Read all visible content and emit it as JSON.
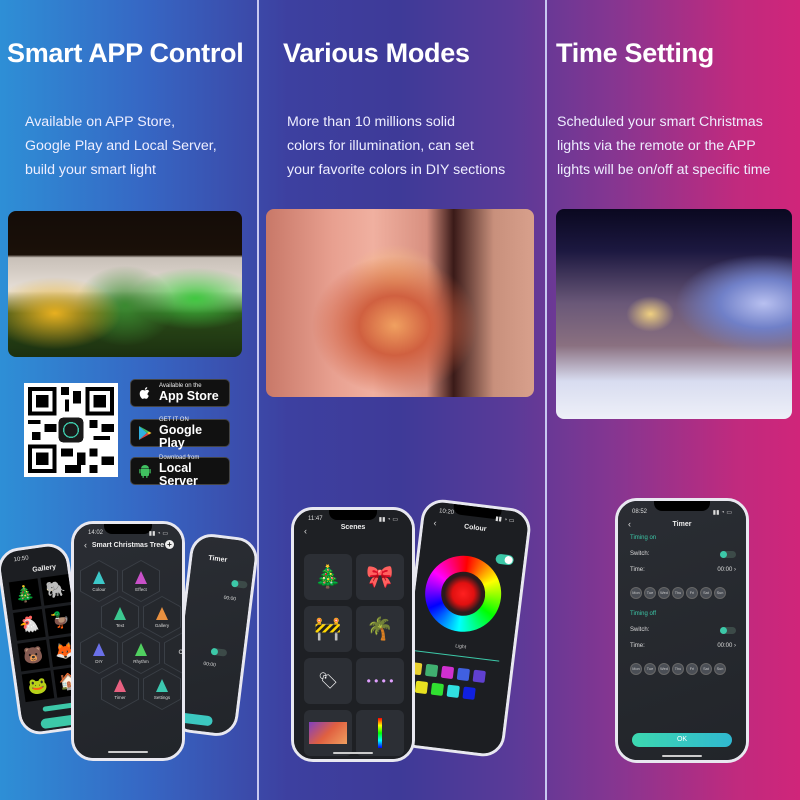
{
  "columns": [
    {
      "title": "Smart APP Control",
      "description": [
        "Available on APP Store,",
        "Google Play and Local Server,",
        "build your smart light"
      ]
    },
    {
      "title": "Various Modes",
      "description": [
        "More than 10 millions solid",
        "colors for illumination, can set",
        "your favorite colors in DIY sections"
      ]
    },
    {
      "title": "Time Setting",
      "description": [
        "Scheduled your smart Christmas",
        "lights via the remote or the APP",
        "lights will be on/off at specific time"
      ]
    }
  ],
  "stores": [
    {
      "small": "Available on the",
      "big": "App Store",
      "icon": "apple-icon"
    },
    {
      "small": "GET IT ON",
      "big": "Google Play",
      "icon": "google-play-icon"
    },
    {
      "small": "Download from",
      "big": "Local Server",
      "icon": "android-icon"
    }
  ],
  "phone_gallery": {
    "time": "10:50",
    "title": "Gallery"
  },
  "phone_tree": {
    "time": "14:02",
    "title": "Smart Christmas Tree",
    "tiles": [
      {
        "label": "Colour",
        "color": "#3cc8c8"
      },
      {
        "label": "Effect",
        "color": "#c850c8"
      },
      {
        "label": "Text",
        "color": "#3cc890"
      },
      {
        "label": "Gallery",
        "color": "#e89040"
      },
      {
        "label": "DIY",
        "color": "#6a70e8"
      },
      {
        "label": "Rhythm",
        "color": "#50d060"
      },
      {
        "label": "Timer",
        "color": "#e86080"
      },
      {
        "label": "Settings",
        "color": "#3cc8b0"
      }
    ],
    "on_label": "ON"
  },
  "phone_timer_back": {
    "title": "Timer",
    "time_value": "00:00"
  },
  "phone_scenes": {
    "time": "11:47",
    "title": "Scenes"
  },
  "phone_colour": {
    "time": "10:20",
    "title": "Colour",
    "light_label": "Light",
    "swatches": [
      "#e8d030",
      "#40b070",
      "#d030d0",
      "#4060e0",
      "#6040d0",
      "#e8e020",
      "#30e030",
      "#30e0e0",
      "#1020e0"
    ]
  },
  "phone_timer": {
    "time": "08:52",
    "title": "Timer",
    "timing_on": "Timing on",
    "timing_off": "Timing off",
    "switch_label": "Switch:",
    "time_label": "Time:",
    "time_value": "00:00",
    "days": [
      "Mon",
      "Tue",
      "Wed",
      "Thu",
      "Fri",
      "Sat",
      "Sun"
    ],
    "ok": "OK"
  },
  "colors": {
    "accent": "#3cc8a8"
  }
}
